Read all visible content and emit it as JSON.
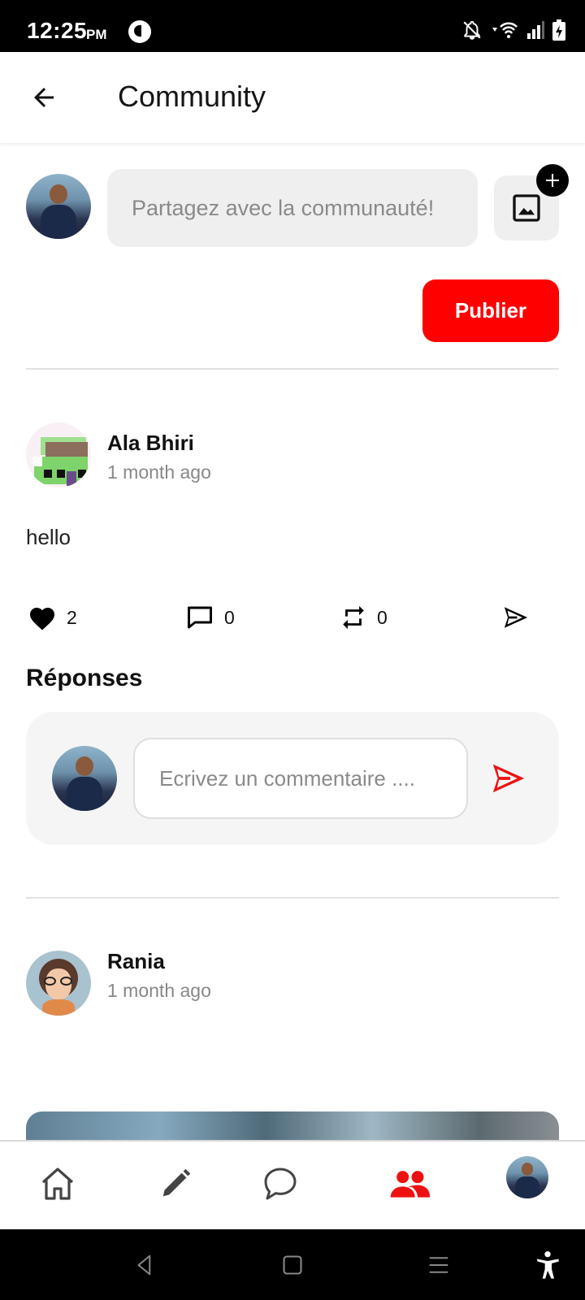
{
  "status_bar": {
    "time": "12:25",
    "ampm": "PM",
    "icons": [
      "app-notification-icon",
      "bell-off-icon",
      "wifi-icon",
      "signal-icon",
      "battery-charging-icon"
    ]
  },
  "app_bar": {
    "back_icon": "arrow-left-icon",
    "title": "Community"
  },
  "composer": {
    "placeholder": "Partagez avec la communauté!",
    "image_icon": "image-icon",
    "add_icon": "plus-icon",
    "publish_label": "Publier"
  },
  "posts": [
    {
      "author": "Ala Bhiri",
      "time": "1 month ago",
      "body": "hello",
      "likes": "2",
      "comments": "0",
      "reposts": "0"
    },
    {
      "author": "Rania",
      "time": "1 month ago"
    }
  ],
  "replies": {
    "title": "Réponses",
    "comment_placeholder": "Ecrivez un commentaire ...."
  },
  "bottom_nav": {
    "items": [
      "home-icon",
      "pencil-icon",
      "chat-icon",
      "community-icon",
      "profile-avatar"
    ],
    "active": "community-icon"
  },
  "colors": {
    "accent": "#ff0000",
    "muted_text": "#888888",
    "input_bg": "#efefef"
  }
}
